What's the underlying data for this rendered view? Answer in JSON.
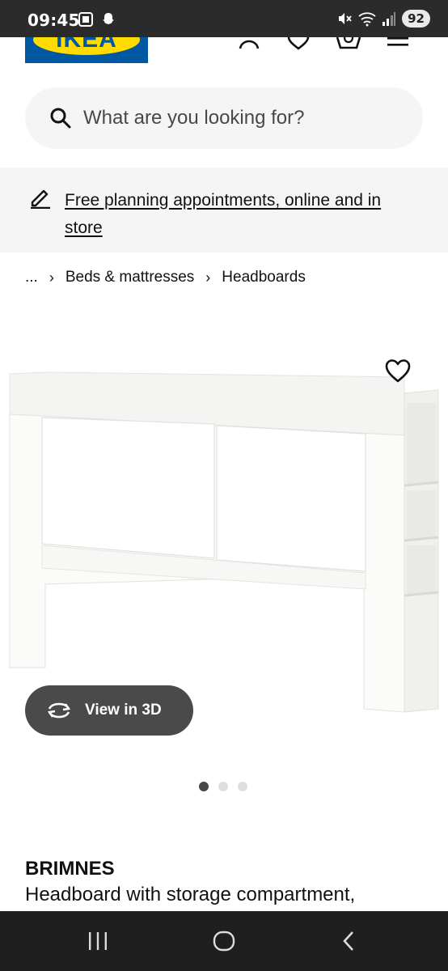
{
  "status_bar": {
    "time": "09:45",
    "battery": "92"
  },
  "header": {
    "logo_text": "IKEA",
    "colors": {
      "logo_blue": "#0058a3",
      "logo_yellow": "#ffdb00"
    }
  },
  "search": {
    "placeholder": "What are you looking for?"
  },
  "promo": {
    "link_text": "Free planning appointments, online and in store"
  },
  "breadcrumb": {
    "ellipsis": "...",
    "items": [
      "Beds & mattresses",
      "Headboards"
    ]
  },
  "product": {
    "view_3d_label": "View in 3D",
    "carousel": {
      "count": 3,
      "active": 1
    },
    "name": "BRIMNES",
    "description": "Headboard with storage compartment,"
  },
  "nav_bar": {
    "icons": [
      "recent-apps-icon",
      "home-icon",
      "back-icon"
    ]
  }
}
